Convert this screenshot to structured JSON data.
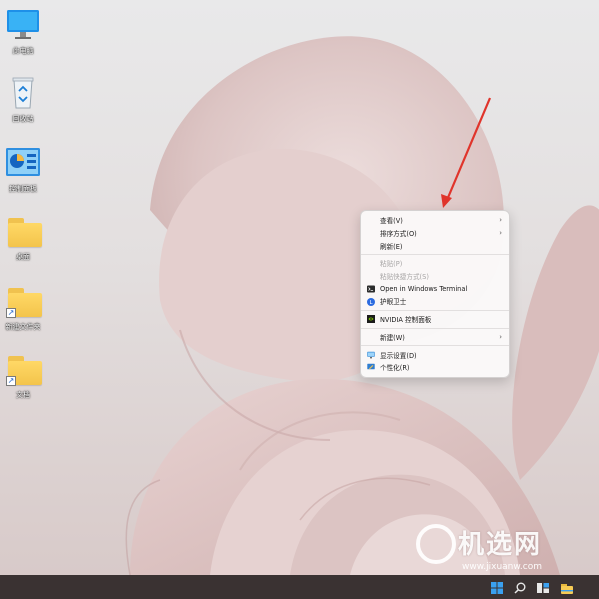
{
  "desktop": {
    "icons": [
      {
        "name": "此电脑",
        "type": "monitor"
      },
      {
        "name": "回收站",
        "type": "recycle-bin"
      },
      {
        "name": "控制面板",
        "type": "control-panel"
      },
      {
        "name": "桌面",
        "type": "folder"
      },
      {
        "name": "新建文件夹",
        "type": "folder-shortcut"
      },
      {
        "name": "文档",
        "type": "folder-shortcut"
      }
    ]
  },
  "context_menu": {
    "items": [
      {
        "label": "查看(V)",
        "enabled": true,
        "submenu": true,
        "icon": ""
      },
      {
        "label": "排序方式(O)",
        "enabled": true,
        "submenu": true,
        "icon": ""
      },
      {
        "label": "刷新(E)",
        "enabled": true,
        "submenu": false,
        "icon": ""
      },
      {
        "label": "粘贴(P)",
        "enabled": false,
        "submenu": false,
        "icon": ""
      },
      {
        "label": "粘贴快捷方式(S)",
        "enabled": false,
        "submenu": false,
        "icon": ""
      },
      {
        "label": "Open in Windows Terminal",
        "enabled": true,
        "submenu": false,
        "icon": "terminal-icon"
      },
      {
        "label": "护眼卫士",
        "enabled": true,
        "submenu": false,
        "icon": "eye-care-icon"
      },
      {
        "label": "NVIDIA 控制面板",
        "enabled": true,
        "submenu": false,
        "icon": "nvidia-icon"
      },
      {
        "label": "新建(W)",
        "enabled": true,
        "submenu": true,
        "icon": ""
      },
      {
        "label": "显示设置(D)",
        "enabled": true,
        "submenu": false,
        "icon": "display-icon"
      },
      {
        "label": "个性化(R)",
        "enabled": true,
        "submenu": false,
        "icon": "personalize-icon"
      }
    ]
  },
  "watermark": {
    "text": "机选网",
    "url": "www.jixuanw.com"
  },
  "taskbar": {
    "icons": [
      "windows-start-icon",
      "search-icon",
      "task-view-icon",
      "file-explorer-icon"
    ]
  },
  "colors": {
    "accent": "#0078d4",
    "annotation_arrow": "#e0342b",
    "taskbar": "#3a3232"
  }
}
